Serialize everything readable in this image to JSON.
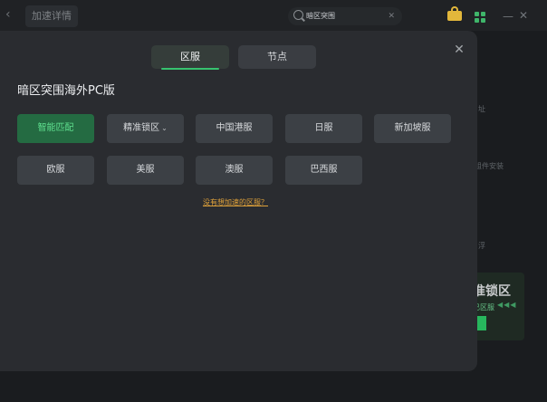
{
  "app": {
    "tab_title": "加速详情",
    "search_value": "暗区突围",
    "side_fragments": [
      "址",
      "组件安装",
      "浮"
    ],
    "promo_title": "准锁区",
    "promo_sub": "已区服",
    "promo_dots": "◀◀◀"
  },
  "modal": {
    "tabs": [
      {
        "label": "区服",
        "active": true
      },
      {
        "label": "节点",
        "active": false
      }
    ],
    "game_title": "暗区突围海外PC版",
    "options_row1": [
      {
        "label": "智能匹配",
        "selected": true
      },
      {
        "label": "精准锁区",
        "has_dropdown": true
      },
      {
        "label": "中国港服"
      },
      {
        "label": "日服"
      },
      {
        "label": "新加坡服"
      }
    ],
    "options_row2": [
      {
        "label": "欧服"
      },
      {
        "label": "美服"
      },
      {
        "label": "澳服"
      },
      {
        "label": "巴西服"
      }
    ],
    "hint_link": "没有想加速的区服？"
  },
  "colors": {
    "accent_green": "#37c36f",
    "selected_bg": "#246b42",
    "link_orange": "#e0a23a"
  }
}
